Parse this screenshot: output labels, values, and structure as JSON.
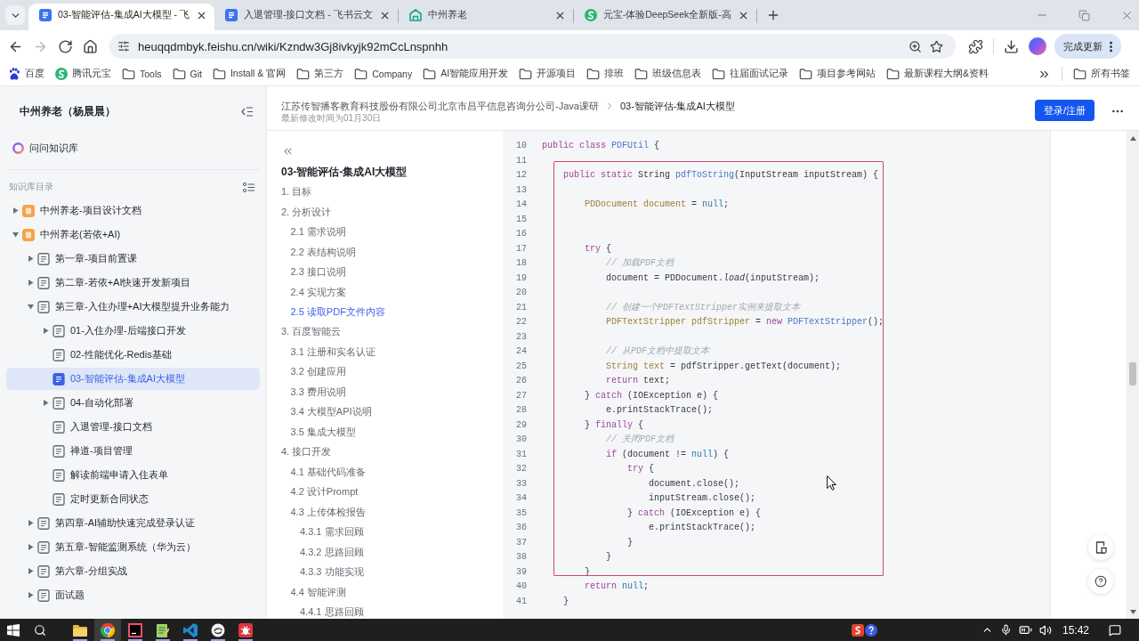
{
  "browser": {
    "tabs": [
      {
        "title": "03-智能评估-集成AI大模型 - 飞",
        "kind": "doc",
        "selected": true
      },
      {
        "title": "入退管理-接口文档 - 飞书云文",
        "kind": "doc",
        "selected": false
      },
      {
        "title": "中州养老",
        "kind": "building",
        "selected": false
      },
      {
        "title": "元宝-体验DeepSeek全新版-高",
        "kind": "round-logo",
        "selected": false
      }
    ],
    "navigation": [
      {
        "kind": "back",
        "disabled": false
      },
      {
        "kind": "forward",
        "disabled": true
      },
      {
        "kind": "reload",
        "disabled": false
      },
      {
        "kind": "home",
        "disabled": false
      }
    ],
    "url": "heuqqdmbyk.feishu.cn/wiki/Kzndw3Gj8ivkyjk92mCcLnspnhh",
    "update_button": "完成更新",
    "bookmarks": [
      {
        "label": "百度",
        "kind": "paw"
      },
      {
        "label": "腾讯元宝",
        "kind": "round-logo"
      },
      {
        "label": "Tools",
        "kind": "folder"
      },
      {
        "label": "Git",
        "kind": "folder"
      },
      {
        "label": "Install & 官网",
        "kind": "folder"
      },
      {
        "label": "第三方",
        "kind": "folder"
      },
      {
        "label": "Company",
        "kind": "folder"
      },
      {
        "label": "AI智能应用开发",
        "kind": "folder"
      },
      {
        "label": "开源项目",
        "kind": "folder"
      },
      {
        "label": "排班",
        "kind": "folder"
      },
      {
        "label": "班级信息表",
        "kind": "folder"
      },
      {
        "label": "往届面试记录",
        "kind": "folder"
      },
      {
        "label": "项目参考网站",
        "kind": "folder"
      },
      {
        "label": "最新课程大纲&资料",
        "kind": "folder"
      }
    ],
    "all_bookmarks": "所有书签"
  },
  "sidebar": {
    "title": "中州养老（杨晨晨）",
    "ask": "问问知识库",
    "section_label": "知识库目录",
    "tree": [
      {
        "label": "中州养老-项目设计文档",
        "kind": "space",
        "selected": false,
        "expanded": false
      },
      {
        "label": "中州养老(若依+AI)",
        "kind": "space",
        "selected": false,
        "expanded": true,
        "children": [
          {
            "label": "第一章-项目前置课",
            "kind": "doc",
            "selected": false,
            "expanded": false
          },
          {
            "label": "第二章-若依+AI快速开发新项目",
            "kind": "doc",
            "selected": false,
            "expanded": false
          },
          {
            "label": "第三章-入住办理+AI大模型提升业务能力",
            "kind": "doc",
            "selected": false,
            "expanded": true,
            "children": [
              {
                "label": "01-入住办理-后端接口开发",
                "kind": "doc",
                "selected": false,
                "expanded": false
              },
              {
                "label": "02-性能优化-Redis基础",
                "kind": "doc",
                "selected": false
              },
              {
                "label": "03-智能评估-集成AI大模型",
                "kind": "doc",
                "selected": true
              },
              {
                "label": "04-自动化部署",
                "kind": "doc",
                "selected": false,
                "expanded": false
              },
              {
                "label": "入退管理-接口文档",
                "kind": "doc",
                "selected": false
              },
              {
                "label": "禅道-项目管理",
                "kind": "doc",
                "selected": false
              },
              {
                "label": "解读前端申请入住表单",
                "kind": "doc",
                "selected": false
              },
              {
                "label": "定时更新合同状态",
                "kind": "doc",
                "selected": false
              }
            ]
          },
          {
            "label": "第四章-AI辅助快速完成登录认证",
            "kind": "doc",
            "selected": false,
            "expanded": false
          },
          {
            "label": "第五章-智能监测系统（华为云）",
            "kind": "doc",
            "selected": false,
            "expanded": false
          },
          {
            "label": "第六章-分组实战",
            "kind": "doc",
            "selected": false,
            "expanded": false
          },
          {
            "label": "面试题",
            "kind": "doc",
            "selected": false,
            "expanded": false
          }
        ]
      }
    ]
  },
  "header": {
    "breadcrumb": [
      "江苏传智播客教育科技股份有限公司北京市昌平信息咨询分公司-Java课研",
      "03-智能评估-集成AI大模型"
    ],
    "modified": "最新修改时间为01月30日",
    "login_button": "登录/注册"
  },
  "outline": {
    "title": "03-智能评估-集成AI大模型",
    "items": [
      {
        "label": "1. 目标",
        "selected": false
      },
      {
        "label": "2. 分析设计",
        "selected": false,
        "children": [
          {
            "label": "2.1 需求说明",
            "selected": false
          },
          {
            "label": "2.2 表结构说明",
            "selected": false
          },
          {
            "label": "2.3 接口说明",
            "selected": false
          },
          {
            "label": "2.4 实现方案",
            "selected": false
          },
          {
            "label": "2.5 读取PDF文件内容",
            "selected": true
          }
        ]
      },
      {
        "label": "3. 百度智能云",
        "selected": false,
        "children": [
          {
            "label": "3.1 注册和实名认证",
            "selected": false
          },
          {
            "label": "3.2 创建应用",
            "selected": false
          },
          {
            "label": "3.3 费用说明",
            "selected": false
          },
          {
            "label": "3.4 大模型API说明",
            "selected": false
          },
          {
            "label": "3.5 集成大模型",
            "selected": false
          }
        ]
      },
      {
        "label": "4. 接口开发",
        "selected": false,
        "children": [
          {
            "label": "4.1 基础代码准备",
            "selected": false
          },
          {
            "label": "4.2 设计Prompt",
            "selected": false
          },
          {
            "label": "4.3 上传体检报告",
            "selected": false,
            "children": [
              {
                "label": "4.3.1 需求回顾",
                "selected": false
              },
              {
                "label": "4.3.2 思路回顾",
                "selected": false
              },
              {
                "label": "4.3.3 功能实现",
                "selected": false
              }
            ]
          },
          {
            "label": "4.4 智能评测",
            "selected": false,
            "children": [
              {
                "label": "4.4.1 思路回顾",
                "selected": false
              }
            ]
          }
        ]
      }
    ]
  },
  "code": {
    "lines": [
      {
        "number": "10",
        "tokens": [
          {
            "text": "public class ",
            "kind": "keyword"
          },
          {
            "text": "PDFUtil",
            "kind": "function"
          },
          {
            "text": " {",
            "kind": "plain"
          }
        ]
      },
      {
        "number": "11"
      },
      {
        "number": "12",
        "tokens": [
          {
            "text": "    public static ",
            "kind": "keyword"
          },
          {
            "text": "String ",
            "kind": "plain"
          },
          {
            "text": "pdfToString",
            "kind": "function"
          },
          {
            "text": "(InputStream inputStream) {",
            "kind": "plain"
          }
        ]
      },
      {
        "number": "13"
      },
      {
        "number": "14",
        "tokens": [
          {
            "text": "        PDDocument document",
            "kind": "declaration"
          },
          {
            "text": " = ",
            "kind": "plain"
          },
          {
            "text": "null",
            "kind": "literal"
          },
          {
            "text": ";",
            "kind": "plain"
          }
        ]
      },
      {
        "number": "15"
      },
      {
        "number": "16"
      },
      {
        "number": "17",
        "tokens": [
          {
            "text": "        try",
            "kind": "keyword"
          },
          {
            "text": " {",
            "kind": "plain"
          }
        ]
      },
      {
        "number": "18",
        "tokens": [
          {
            "text": "            // 加载PDF文档",
            "kind": "comment"
          }
        ]
      },
      {
        "number": "19",
        "tokens": [
          {
            "text": "            document = PDDocument.",
            "kind": "plain"
          },
          {
            "text": "load",
            "kind": "static"
          },
          {
            "text": "(inputStream);",
            "kind": "plain"
          }
        ]
      },
      {
        "number": "20"
      },
      {
        "number": "21",
        "tokens": [
          {
            "text": "            // 创建一个PDFTextStripper实例来提取文本",
            "kind": "comment"
          }
        ]
      },
      {
        "number": "22",
        "tokens": [
          {
            "text": "            PDFTextStripper pdfStripper",
            "kind": "declaration"
          },
          {
            "text": " = ",
            "kind": "plain"
          },
          {
            "text": "new ",
            "kind": "keyword"
          },
          {
            "text": "PDFTextStripper",
            "kind": "function"
          },
          {
            "text": "();",
            "kind": "plain"
          }
        ]
      },
      {
        "number": "23"
      },
      {
        "number": "24",
        "tokens": [
          {
            "text": "            // 从PDF文档中提取文本",
            "kind": "comment"
          }
        ]
      },
      {
        "number": "25",
        "tokens": [
          {
            "text": "            String text",
            "kind": "declaration"
          },
          {
            "text": " = pdfStripper.getText(document);",
            "kind": "plain"
          }
        ]
      },
      {
        "number": "26",
        "tokens": [
          {
            "text": "            return",
            "kind": "keyword"
          },
          {
            "text": " text;",
            "kind": "plain"
          }
        ]
      },
      {
        "number": "27",
        "tokens": [
          {
            "text": "        } ",
            "kind": "plain"
          },
          {
            "text": "catch",
            "kind": "keyword"
          },
          {
            "text": " (IOException e) {",
            "kind": "plain"
          }
        ]
      },
      {
        "number": "28",
        "tokens": [
          {
            "text": "            e.printStackTrace();",
            "kind": "plain"
          }
        ]
      },
      {
        "number": "29",
        "tokens": [
          {
            "text": "        } ",
            "kind": "plain"
          },
          {
            "text": "finally",
            "kind": "keyword"
          },
          {
            "text": " {",
            "kind": "plain"
          }
        ]
      },
      {
        "number": "30",
        "tokens": [
          {
            "text": "            // 关闭PDF文档",
            "kind": "comment"
          }
        ]
      },
      {
        "number": "31",
        "tokens": [
          {
            "text": "            if",
            "kind": "keyword"
          },
          {
            "text": " (document != ",
            "kind": "plain"
          },
          {
            "text": "null",
            "kind": "literal"
          },
          {
            "text": ") {",
            "kind": "plain"
          }
        ]
      },
      {
        "number": "32",
        "tokens": [
          {
            "text": "                try",
            "kind": "keyword"
          },
          {
            "text": " {",
            "kind": "plain"
          }
        ]
      },
      {
        "number": "33",
        "tokens": [
          {
            "text": "                    document.close();",
            "kind": "plain"
          }
        ]
      },
      {
        "number": "34",
        "tokens": [
          {
            "text": "                    inputStream.close();",
            "kind": "plain"
          }
        ]
      },
      {
        "number": "35",
        "tokens": [
          {
            "text": "                } ",
            "kind": "plain"
          },
          {
            "text": "catch",
            "kind": "keyword"
          },
          {
            "text": " (IOException e) {",
            "kind": "plain"
          }
        ]
      },
      {
        "number": "36",
        "tokens": [
          {
            "text": "                    e.printStackTrace();",
            "kind": "plain"
          }
        ]
      },
      {
        "number": "37",
        "tokens": [
          {
            "text": "                }",
            "kind": "plain"
          }
        ]
      },
      {
        "number": "38",
        "tokens": [
          {
            "text": "            }",
            "kind": "plain"
          }
        ]
      },
      {
        "number": "39",
        "tokens": [
          {
            "text": "        }",
            "kind": "plain"
          }
        ]
      },
      {
        "number": "40",
        "tokens": [
          {
            "text": "        return ",
            "kind": "keyword"
          },
          {
            "text": "null",
            "kind": "literal"
          },
          {
            "text": ";",
            "kind": "plain"
          }
        ]
      },
      {
        "number": "41",
        "tokens": [
          {
            "text": "    }",
            "kind": "plain"
          }
        ]
      }
    ]
  },
  "taskbar": {
    "apps": [
      {
        "kind": "folder",
        "running": true,
        "selected": false
      },
      {
        "kind": "browser",
        "running": true,
        "selected": true
      },
      {
        "kind": "tile",
        "running": true,
        "selected": false
      },
      {
        "kind": "notepad",
        "running": true,
        "selected": false
      },
      {
        "kind": "ribbon",
        "running": true,
        "selected": false
      },
      {
        "kind": "circle",
        "running": true,
        "selected": false
      },
      {
        "kind": "bug",
        "running": true,
        "selected": false
      }
    ],
    "time": "15:42"
  }
}
